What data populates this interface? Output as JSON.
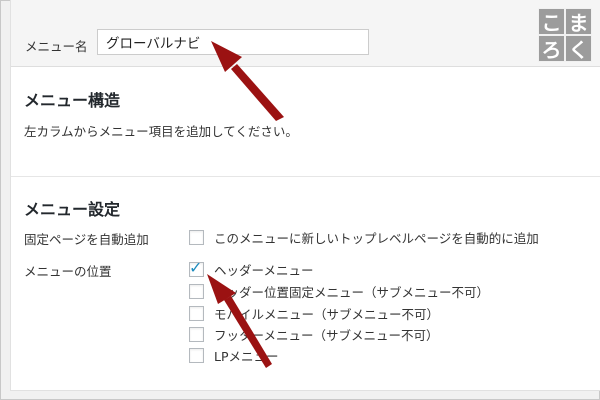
{
  "header": {
    "menu_name_label": "メニュー名",
    "menu_name_value": "グローバルナビ"
  },
  "logo": {
    "chars": [
      "こ",
      "ま",
      "ろ",
      "く"
    ]
  },
  "structure": {
    "title": "メニュー構造",
    "description": "左カラムからメニュー項目を追加してください。"
  },
  "settings": {
    "title": "メニュー設定",
    "auto_add": {
      "label": "固定ページを自動追加",
      "option": {
        "text": "このメニューに新しいトップレベルページを自動的に追加",
        "checked": false
      }
    },
    "locations": {
      "label": "メニューの位置",
      "options": [
        {
          "text": "ヘッダーメニュー",
          "checked": true
        },
        {
          "text": "ヘッダー位置固定メニュー（サブメニュー不可）",
          "checked": false
        },
        {
          "text": "モバイルメニュー（サブメニュー不可）",
          "checked": false
        },
        {
          "text": "フッターメニュー（サブメニュー不可）",
          "checked": false
        },
        {
          "text": "LPメニュー",
          "checked": false
        }
      ]
    }
  },
  "colors": {
    "arrow": "#9b1212",
    "checkmark": "#1e8cbe",
    "logo_bg": "#9c9c9c"
  }
}
